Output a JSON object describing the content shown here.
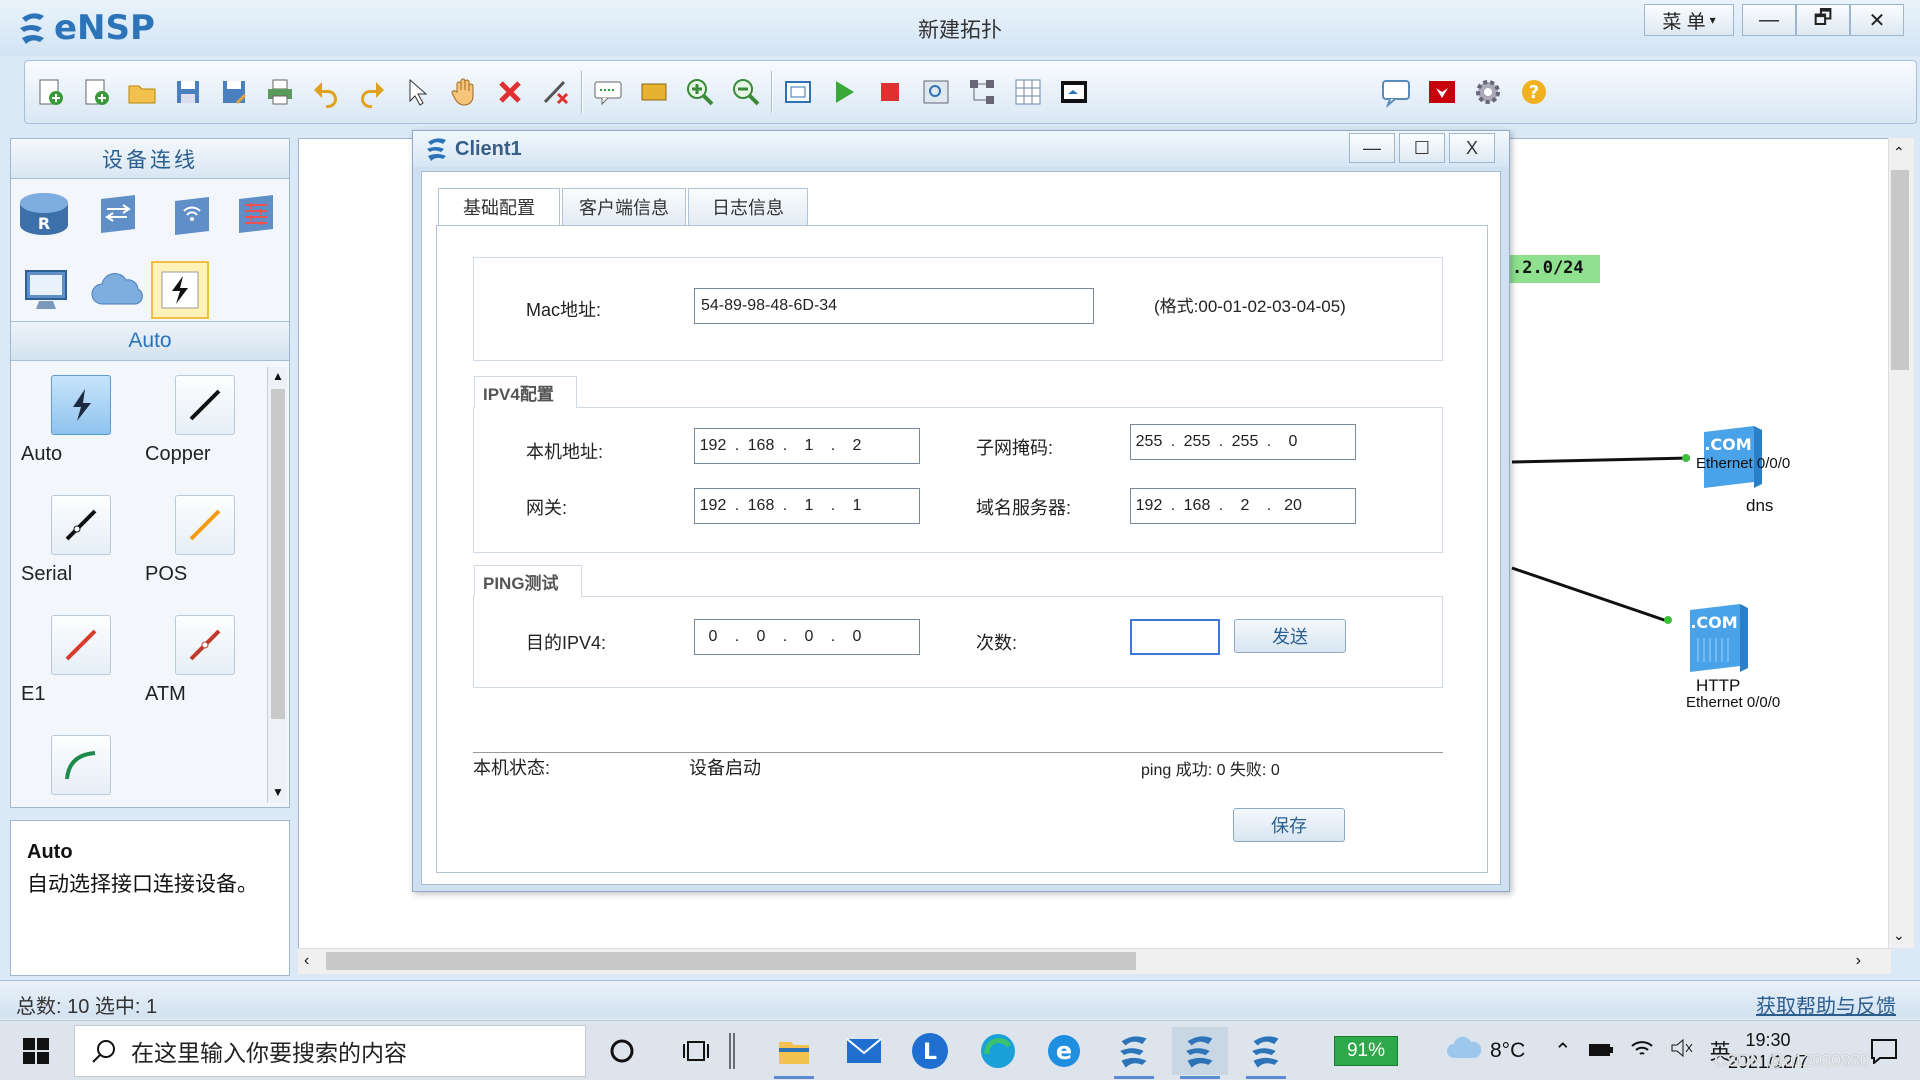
{
  "app": {
    "name": "eNSP",
    "title": "新建拓扑",
    "menu_label": "菜 单"
  },
  "toolbar": {
    "left_icons": [
      "new-topology-icon",
      "new-example-icon",
      "open-icon",
      "save-icon",
      "save-as-icon",
      "print-icon",
      "undo-icon",
      "redo-icon",
      "select-icon",
      "pan-hand-icon",
      "delete-icon",
      "delete-links-icon",
      "text-note-icon",
      "rectangle-icon",
      "zoom-in-icon",
      "zoom-out-icon",
      "fit-view-icon",
      "start-device-icon",
      "stop-device-icon",
      "capture-icon",
      "topology-icon",
      "grid-icon",
      "console-icon"
    ],
    "right_icons": [
      "chat-icon",
      "huawei-logo-icon",
      "settings-icon",
      "help-icon"
    ]
  },
  "left_panel": {
    "title": "设备连线",
    "device_icons": [
      "router-icon",
      "switch-icon",
      "wlan-icon",
      "firewall-icon",
      "pc-icon",
      "cloud-icon",
      "link-icon"
    ],
    "subheader": "Auto",
    "cables": [
      {
        "label": "Auto",
        "icon": "auto-cable-icon",
        "color": "#2c3e50"
      },
      {
        "label": "Copper",
        "icon": "copper-cable-icon",
        "color": "#111111"
      },
      {
        "label": "Serial",
        "icon": "serial-cable-icon",
        "color": "#111111"
      },
      {
        "label": "POS",
        "icon": "pos-cable-icon",
        "color": "#f39c12"
      },
      {
        "label": "E1",
        "icon": "e1-cable-icon",
        "color": "#d93a2b"
      },
      {
        "label": "ATM",
        "icon": "atm-cable-icon",
        "color": "#c0392b"
      },
      {
        "label": "",
        "icon": "ctl-cable-icon",
        "color": "#1e8a4c"
      }
    ],
    "description": {
      "title": "Auto",
      "text": "自动选择接口连接设备。"
    }
  },
  "canvas": {
    "network_label": ".2.0/24",
    "nodes": [
      {
        "name": "dns",
        "interface": "Ethernet 0/0/0"
      },
      {
        "name": "HTTP",
        "interface": "Ethernet 0/0/0"
      }
    ]
  },
  "status_bar": {
    "left": "总数: 10 选中: 1",
    "right": "获取帮助与反馈"
  },
  "dialog": {
    "title": "Client1",
    "tabs": [
      "基础配置",
      "客户端信息",
      "日志信息"
    ],
    "active_tab": "基础配置",
    "mac": {
      "label": "Mac地址:",
      "value": "54-89-98-48-6D-34",
      "hint": "(格式:00-01-02-03-04-05)"
    },
    "ipv4": {
      "group_label": "IPV4配置",
      "local_label": "本机地址:",
      "local": [
        "192",
        "168",
        "1",
        "2"
      ],
      "mask_label": "子网掩码:",
      "mask": [
        "255",
        "255",
        "255",
        "0"
      ],
      "gateway_label": "网关:",
      "gateway": [
        "192",
        "168",
        "1",
        "1"
      ],
      "dns_label": "域名服务器:",
      "dns": [
        "192",
        "168",
        "2",
        "20"
      ]
    },
    "ping": {
      "group_label": "PING测试",
      "dest_label": "目的IPV4:",
      "dest": [
        "0",
        "0",
        "0",
        "0"
      ],
      "count_label": "次数:",
      "count_value": "",
      "send_label": "发送"
    },
    "status": {
      "label": "本机状态:",
      "value": "设备启动",
      "ping_result": "ping 成功: 0 失败: 0"
    },
    "save_label": "保存"
  },
  "taskbar": {
    "search_placeholder": "在这里输入你要搜索的内容",
    "battery": "91%",
    "weather": "8°C",
    "ime": "英",
    "time": "19:30",
    "date": "2021/12/7",
    "watermark": "CSDN @u12030830"
  }
}
